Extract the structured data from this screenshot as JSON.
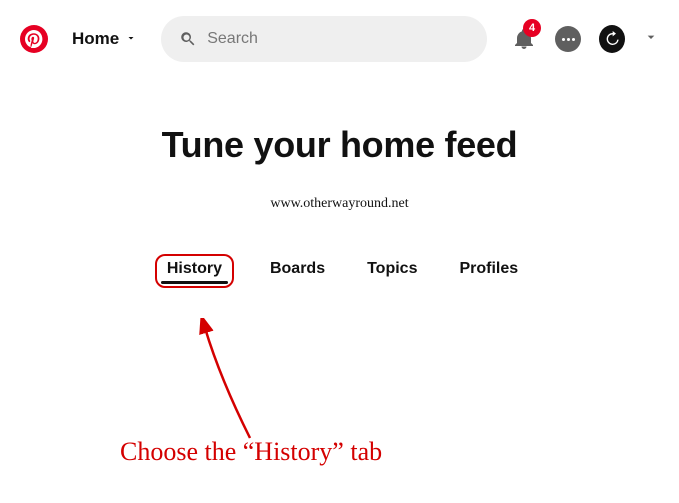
{
  "header": {
    "home_label": "Home",
    "search_placeholder": "Search",
    "notification_count": "4"
  },
  "page": {
    "title": "Tune your home feed",
    "watermark": "www.otherwayround.net"
  },
  "tabs": {
    "items": [
      {
        "label": "History"
      },
      {
        "label": "Boards"
      },
      {
        "label": "Topics"
      },
      {
        "label": "Profiles"
      }
    ]
  },
  "annotation": {
    "text": "Choose the “History” tab"
  }
}
